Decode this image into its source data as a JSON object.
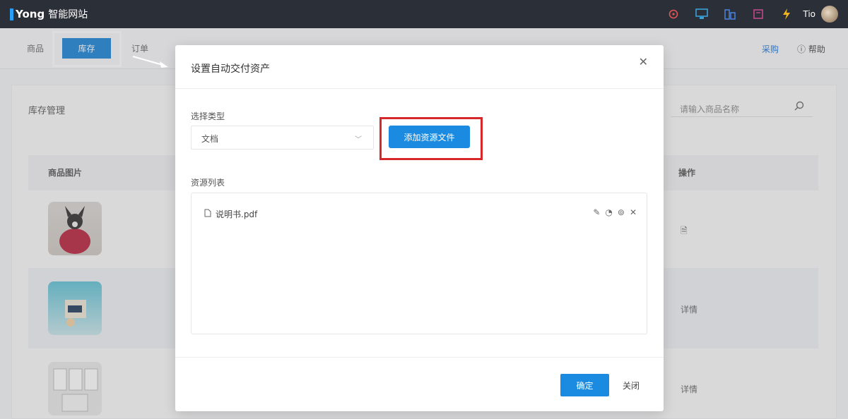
{
  "app": {
    "logo": "Yong",
    "logo_sub": "智能网站"
  },
  "topbar": {
    "user": "Tio"
  },
  "nav": {
    "item1": "商品",
    "item_active": "库存",
    "item3": "订单",
    "right_link": "采购",
    "help": "帮助"
  },
  "page": {
    "title": "库存管理",
    "search_placeholder": "请输入商品名称",
    "col_image": "商品图片",
    "col_ops": "操作",
    "rows": [
      {
        "op": ""
      },
      {
        "op": "详情"
      },
      {
        "op": "详情"
      }
    ]
  },
  "modal": {
    "title": "设置自动交付资产",
    "type_label": "选择类型",
    "type_value": "文档",
    "add_button": "添加资源文件",
    "list_label": "资源列表",
    "file_name": "说明书.pdf",
    "confirm": "确定",
    "cancel": "关闭"
  },
  "colors": {
    "primary": "#1a8be0",
    "highlight_red": "#d62828",
    "topbar": "#2b2f38"
  }
}
